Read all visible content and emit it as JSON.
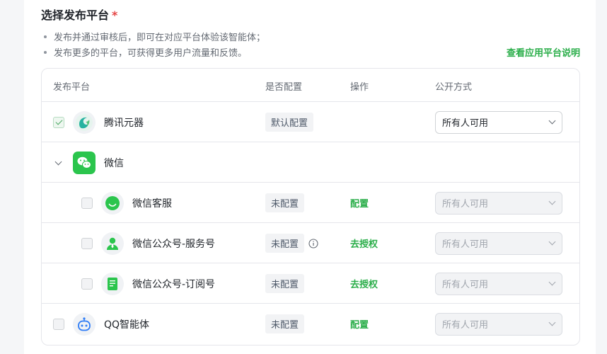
{
  "section": {
    "title": "选择发布平台",
    "required_mark": "*"
  },
  "hints": [
    "发布并通过审核后，即可在对应平台体验该智能体；",
    "发布更多的平台，可获得更多用户流量和反馈。"
  ],
  "guide_link": "查看应用平台说明",
  "table": {
    "headers": {
      "platform": "发布平台",
      "configured": "是否配置",
      "action": "操作",
      "visibility": "公开方式"
    },
    "rows": {
      "yuanqi": {
        "name": "腾讯元器",
        "status": "默认配置",
        "visibility": "所有人可用",
        "checked": true
      },
      "wechat": {
        "name": "微信"
      },
      "wechat_service": {
        "name": "微信客服",
        "status": "未配置",
        "action": "配置",
        "visibility": "所有人可用"
      },
      "wechat_service_account": {
        "name": "微信公众号-服务号",
        "status": "未配置",
        "action": "去授权",
        "visibility": "所有人可用"
      },
      "wechat_subscription": {
        "name": "微信公众号-订阅号",
        "status": "未配置",
        "action": "去授权",
        "visibility": "所有人可用"
      },
      "qq": {
        "name": "QQ智能体",
        "status": "未配置",
        "action": "配置",
        "visibility": "所有人可用"
      }
    }
  },
  "colors": {
    "accent": "#2bae4a",
    "required": "#e54545",
    "wechat_green": "#2bc54d"
  }
}
